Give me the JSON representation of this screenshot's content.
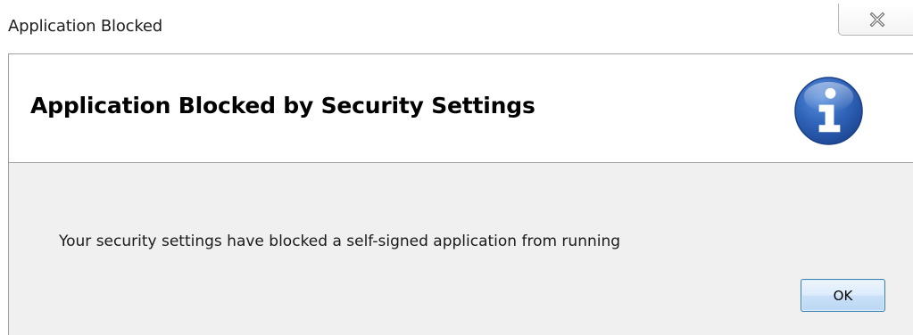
{
  "window": {
    "title": "Application Blocked",
    "close_icon": "close-x-icon"
  },
  "dialog": {
    "heading": "Application Blocked by Security Settings",
    "header_icon": "info-icon",
    "message": "Your security settings have blocked a self-signed application from running",
    "ok_label": "OK"
  },
  "colors": {
    "info_blue": "#2a5caa",
    "panel_bg": "#f0f0f0",
    "button_border": "#3c7fb1"
  }
}
